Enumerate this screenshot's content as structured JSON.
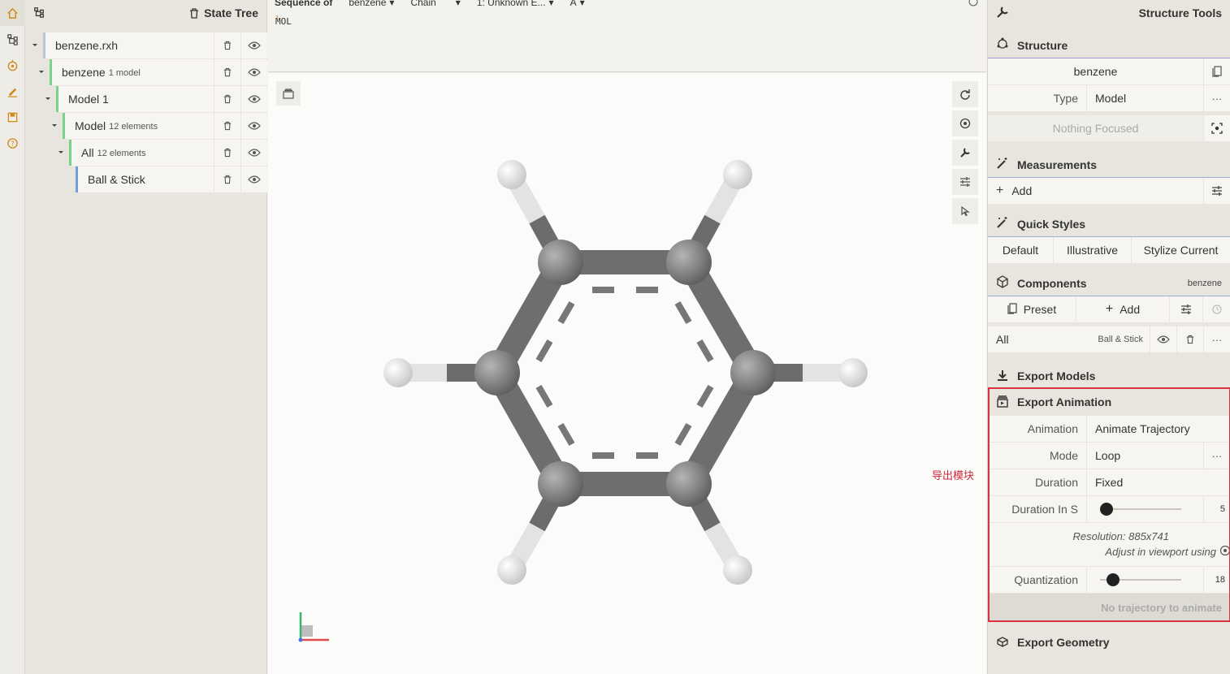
{
  "state_tree": {
    "title": "State Tree",
    "rows": [
      {
        "label": "benzene.rxh",
        "sub": ""
      },
      {
        "label": "benzene",
        "sub": "1 model"
      },
      {
        "label": "Model 1",
        "sub": ""
      },
      {
        "label": "Model",
        "sub": "12 elements"
      },
      {
        "label": "All",
        "sub": "12 elements"
      },
      {
        "label": "Ball & Stick",
        "sub": ""
      }
    ]
  },
  "sequence": {
    "title": "Sequence of",
    "structure": "benzene",
    "mode": "Chain",
    "entity": "1: Unknown E...",
    "chain": "A",
    "number": "1",
    "residue": "MOL"
  },
  "viewport": {
    "annotation": "导出模块",
    "colors": {
      "carbon": "#777777",
      "hydrogen": "#e8e8e8",
      "annotation": "#d0283c"
    }
  },
  "right_panel": {
    "title": "Structure Tools",
    "structure": {
      "header": "Structure",
      "name": "benzene",
      "type_label": "Type",
      "type_value": "Model",
      "focus": "Nothing Focused"
    },
    "measurements": {
      "header": "Measurements",
      "add": "Add"
    },
    "quick_styles": {
      "header": "Quick Styles",
      "buttons": [
        "Default",
        "Illustrative",
        "Stylize Current"
      ]
    },
    "components": {
      "header": "Components",
      "structure": "benzene",
      "preset": "Preset",
      "add": "Add",
      "item_label": "All",
      "item_repr": "Ball & Stick"
    },
    "export_models": {
      "header": "Export Models"
    },
    "export_animation": {
      "header": "Export Animation",
      "animation_label": "Animation",
      "animation_value": "Animate Trajectory",
      "mode_label": "Mode",
      "mode_value": "Loop",
      "duration_label": "Duration",
      "duration_value": "Fixed",
      "duration_s_label": "Duration In S",
      "duration_s_value": "5",
      "duration_s_fraction": 0.0,
      "resolution": "Resolution: 885x741",
      "adjust": "Adjust in viewport using",
      "quantization_label": "Quantization",
      "quantization_value": "18",
      "quantization_fraction": 0.1,
      "status": "No trajectory to animate"
    },
    "export_geometry": {
      "header": "Export Geometry"
    }
  }
}
